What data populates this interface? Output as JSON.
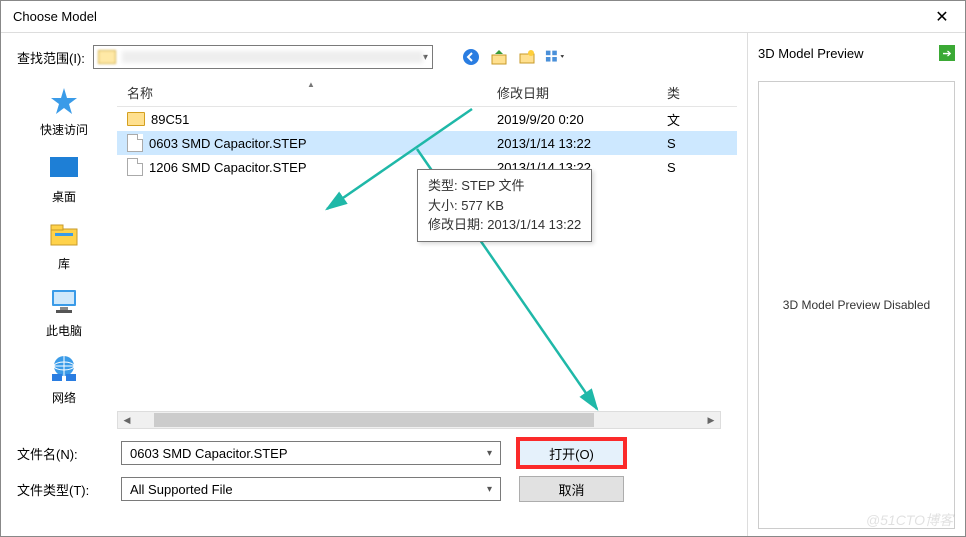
{
  "window": {
    "title": "Choose Model"
  },
  "lookin": {
    "label": "查找范围(I):"
  },
  "nav_icons": [
    "back-icon",
    "up-icon",
    "new-folder-icon",
    "view-menu-icon"
  ],
  "places": [
    {
      "key": "quick",
      "label": "快速访问"
    },
    {
      "key": "desktop",
      "label": "桌面"
    },
    {
      "key": "libraries",
      "label": "库"
    },
    {
      "key": "thispc",
      "label": "此电脑"
    },
    {
      "key": "network",
      "label": "网络"
    }
  ],
  "columns": {
    "name": "名称",
    "date": "修改日期",
    "type": "类"
  },
  "files": [
    {
      "icon": "folder",
      "name": "89C51",
      "date": "2019/9/20 0:20",
      "type": "文",
      "selected": false
    },
    {
      "icon": "file",
      "name": "0603 SMD Capacitor.STEP",
      "date": "2013/1/14 13:22",
      "type": "S",
      "selected": true
    },
    {
      "icon": "file",
      "name": "1206 SMD Capacitor.STEP",
      "date": "2013/1/14 13:22",
      "type": "S",
      "selected": false
    }
  ],
  "tooltip": {
    "line1": "类型: STEP 文件",
    "line2": "大小: 577 KB",
    "line3": "修改日期: 2013/1/14 13:22"
  },
  "filename": {
    "label": "文件名(N):",
    "value": "0603 SMD Capacitor.STEP"
  },
  "filetype": {
    "label": "文件类型(T):",
    "value": "All Supported File"
  },
  "buttons": {
    "open": "打开(O)",
    "cancel": "取消"
  },
  "preview": {
    "header": "3D Model Preview",
    "body": "3D Model Preview Disabled"
  },
  "watermark": "@51CTO博客"
}
